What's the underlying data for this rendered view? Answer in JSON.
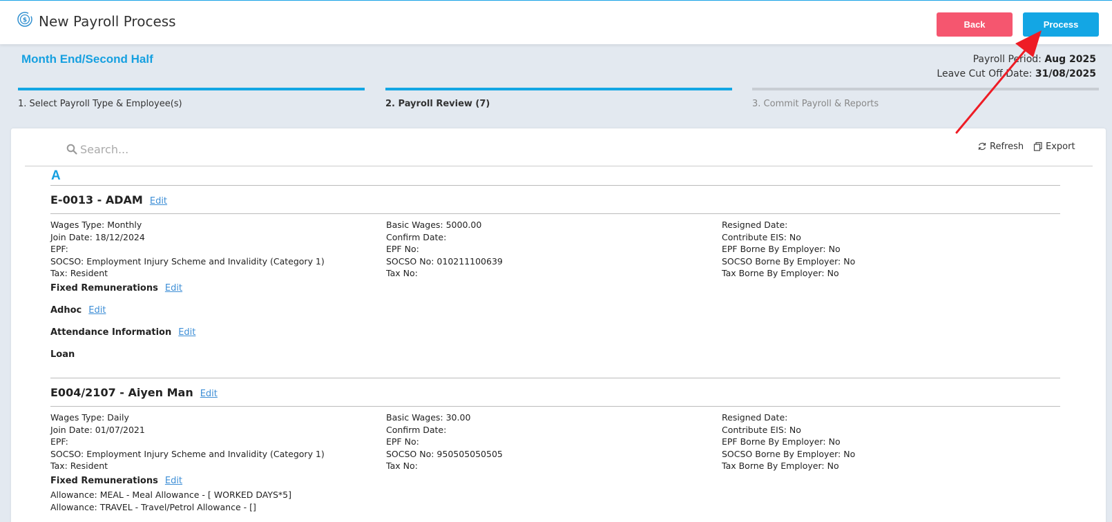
{
  "header": {
    "title": "New Payroll Process",
    "back_label": "Back",
    "process_label": "Process"
  },
  "subtitle": "Month End/Second Half",
  "period": {
    "payroll_label": "Payroll Period: ",
    "payroll_value": "Aug 2025",
    "leave_label": "Leave Cut Off Date: ",
    "leave_value": "31/08/2025"
  },
  "steps": [
    {
      "label": "1. Select Payroll Type & Employee(s)",
      "state": "done"
    },
    {
      "label": "2. Payroll Review (7)",
      "state": "active"
    },
    {
      "label": "3. Commit Payroll & Reports",
      "state": "pending"
    }
  ],
  "toolbar": {
    "search_placeholder": "Search...",
    "refresh_label": "Refresh",
    "export_label": "Export"
  },
  "group_letter": "A",
  "employees": [
    {
      "name": "E-0013 - ADAM",
      "edit": "Edit",
      "col1": [
        "Wages Type: Monthly",
        "Join Date: 18/12/2024",
        "EPF:",
        "SOCSO: Employment Injury Scheme and Invalidity (Category 1)",
        "Tax: Resident"
      ],
      "col2": [
        "Basic Wages: 5000.00",
        "Confirm Date:",
        "EPF No:",
        "SOCSO No: 010211100639",
        "Tax No:"
      ],
      "col3": [
        "Resigned Date:",
        "Contribute EIS: No",
        "EPF Borne By Employer: No",
        "SOCSO Borne By Employer: No",
        "Tax Borne By Employer: No"
      ],
      "fixed_label": "Fixed Remunerations",
      "adhoc_label": "Adhoc",
      "attendance_label": "Attendance Information",
      "loan_label": "Loan"
    },
    {
      "name": "E004/2107 - Aiyen Man",
      "edit": "Edit",
      "col1": [
        "Wages Type: Daily",
        "Join Date: 01/07/2021",
        "EPF:",
        "SOCSO: Employment Injury Scheme and Invalidity (Category 1)",
        "Tax: Resident"
      ],
      "col2": [
        "Basic Wages: 30.00",
        "Confirm Date:",
        "EPF No:",
        "SOCSO No: 950505050505",
        "Tax No:"
      ],
      "col3": [
        "Resigned Date:",
        "Contribute EIS: No",
        "EPF Borne By Employer: No",
        "SOCSO Borne By Employer: No",
        "Tax Borne By Employer: No"
      ],
      "fixed_label": "Fixed Remunerations",
      "fixed_items": [
        "Allowance: MEAL - Meal Allowance - [ WORKED DAYS*5]",
        "Allowance: TRAVEL - Travel/Petrol Allowance - []"
      ]
    }
  ],
  "colors": {
    "accent": "#13a6e4",
    "back": "#f5566f",
    "arrow": "#ee1c25"
  }
}
